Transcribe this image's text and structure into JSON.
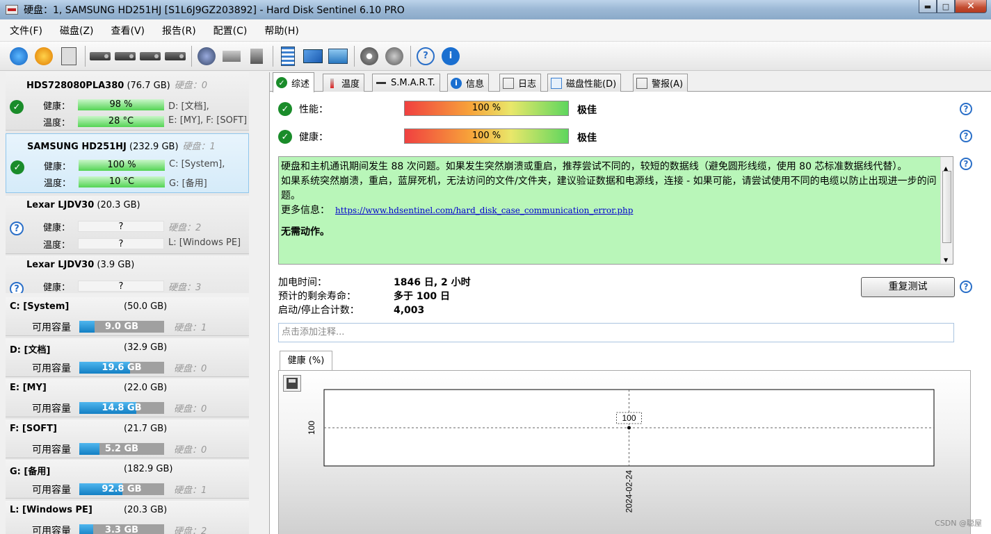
{
  "window": {
    "title": "硬盘：1, SAMSUNG HD251HJ [S1L6J9GZ203892]  -  Hard Disk Sentinel 6.10 PRO",
    "min": "▬",
    "max": "□",
    "close": "✕"
  },
  "menu": [
    "文件(F)",
    "磁盘(Z)",
    "查看(V)",
    "报告(R)",
    "配置(C)",
    "帮助(H)"
  ],
  "toolbar": {
    "icons": [
      "refresh-icon",
      "alert-refresh-icon",
      "disk-info-icon",
      "disk-icon",
      "disk-clock-icon",
      "disk-check-icon",
      "disk-arrow-icon",
      "network-disk-icon",
      "printer-icon",
      "usb-icon",
      "report-icon",
      "email-icon",
      "monitor-icon",
      "settings-icon",
      "sound-icon",
      "help-icon",
      "info-icon"
    ]
  },
  "disks": [
    {
      "model": "HDS728080PLA380",
      "size": "(76.7 GB)",
      "num": "硬盘：0",
      "health_label": "健康：",
      "health": "98 %",
      "temp_label": "温度：",
      "temp": "28 °C",
      "vol1": "D: [文档],",
      "vol2": "E: [MY], F: [SOFT]",
      "status": "ok",
      "health_fill": 0.98
    },
    {
      "model": "SAMSUNG HD251HJ",
      "size": "(232.9 GB)",
      "num": "硬盘：1",
      "health_label": "健康：",
      "health": "100 %",
      "temp_label": "温度：",
      "temp": "10 °C",
      "vol1": "C: [System],",
      "vol2": "G: [备用]",
      "status": "ok",
      "health_fill": 1.0
    },
    {
      "model": "Lexar   LJDV30",
      "size": "(20.3 GB)",
      "num": "",
      "health_label": "健康：",
      "health": "?",
      "temp_label": "温度：",
      "temp": "?",
      "vol1": "硬盘：2",
      "vol2": "L: [Windows PE]",
      "status": "unk",
      "health_fill": 0
    },
    {
      "model": "Lexar   LJDV30",
      "size": "(3.9 GB)",
      "num": "",
      "health_label": "健康：",
      "health": "?",
      "temp_label": "",
      "temp": "",
      "vol1": "硬盘：3",
      "vol2": "",
      "status": "unk",
      "health_fill": 0
    }
  ],
  "volumes": [
    {
      "name": "C: [System]",
      "size": "(50.0 GB)",
      "avail_label": "可用容量",
      "free": "9.0 GB",
      "free_ratio": 0.18,
      "disk": "硬盘：1"
    },
    {
      "name": "D: [文档]",
      "size": "(32.9 GB)",
      "avail_label": "可用容量",
      "free": "19.6 GB",
      "free_ratio": 0.6,
      "disk": "硬盘：0"
    },
    {
      "name": "E: [MY]",
      "size": "(22.0 GB)",
      "avail_label": "可用容量",
      "free": "14.8 GB",
      "free_ratio": 0.67,
      "disk": "硬盘：0"
    },
    {
      "name": "F: [SOFT]",
      "size": "(21.7 GB)",
      "avail_label": "可用容量",
      "free": "5.2 GB",
      "free_ratio": 0.24,
      "disk": "硬盘：0"
    },
    {
      "name": "G: [备用]",
      "size": "(182.9 GB)",
      "avail_label": "可用容量",
      "free": "92.8 GB",
      "free_ratio": 0.51,
      "disk": "硬盘：1"
    },
    {
      "name": "L: [Windows PE]",
      "size": "(20.3 GB)",
      "avail_label": "可用容量",
      "free": "3.3 GB",
      "free_ratio": 0.16,
      "disk": "硬盘：2"
    }
  ],
  "tabs": [
    {
      "label": "综述",
      "icon": "check-icon"
    },
    {
      "label": "温度",
      "icon": "thermometer-icon"
    },
    {
      "label": "S.M.A.R.T.",
      "icon": "smart-icon"
    },
    {
      "label": "信息",
      "icon": "info-icon"
    },
    {
      "label": "日志",
      "icon": "log-icon"
    },
    {
      "label": "磁盘性能(D)",
      "icon": "performance-icon"
    },
    {
      "label": "警报(A)",
      "icon": "alert-icon"
    }
  ],
  "summary": {
    "perf_label": "性能：",
    "perf_value": "100 %",
    "perf_rating": "极佳",
    "perf_level": 1.0,
    "health_label": "健康：",
    "health_value": "100 %",
    "health_rating": "极佳",
    "health_level": 1.0,
    "msg_line1": "硬盘和主机通讯期间发生 88 次问题。如果发生突然崩溃或重启，推荐尝试不同的，较短的数据线（避免圆形线缆，使用 80 芯标准数据线代替）。",
    "msg_line2": "如果系统突然崩溃，重启，蓝屏死机，无法访问的文件/文件夹，建议验证数据和电源线，连接 - 如果可能，请尝试使用不同的电缆以防止出现进一步的问题。",
    "msg_more": "更多信息：",
    "msg_link": "https://www.hdsentinel.com/hard_disk_case_communication_error.php",
    "msg_action": "无需动作。",
    "power_on_label": "加电时间：",
    "power_on": "1846 日, 2 小时",
    "life_label": "预计的剩余寿命：",
    "life": "多于 100 日",
    "starts_label": "启动/停止合计数：",
    "starts": "4,003",
    "retest": "重复测试",
    "note_placeholder": "点击添加注释..."
  },
  "chart_tab": "健康 (%)",
  "chart_data": {
    "type": "line",
    "title": "",
    "series": [
      {
        "name": "健康 (%)",
        "x": [
          "2024-02-24"
        ],
        "values": [
          100
        ]
      }
    ],
    "x_tick_labels": [
      "2024-02-24"
    ],
    "y_tick_labels": [
      "100"
    ],
    "data_labels": [
      "100"
    ],
    "grid": true
  },
  "watermark": "CSDN @聪屋"
}
